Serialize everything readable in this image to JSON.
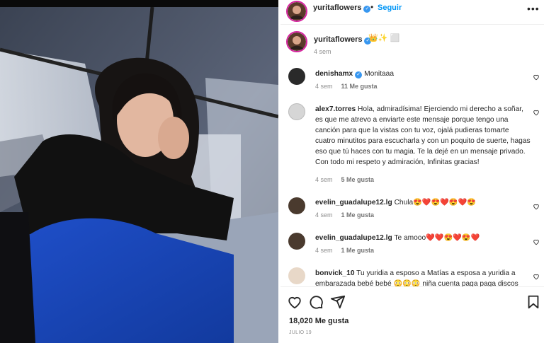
{
  "post": {
    "username": "yuritaflowers",
    "follow_label": "Seguir",
    "separator": "•",
    "more_label": "•••",
    "caption_emoji": "👑✨ ⬜",
    "caption_time": "4 sem"
  },
  "comments": [
    {
      "user": "denishamx",
      "verified": true,
      "text": "Monitaaa",
      "time": "4 sem",
      "likes": "11 Me gusta",
      "avatar_color": "#2a2a2a"
    },
    {
      "user": "alex7.torres",
      "verified": false,
      "text": "Hola, admiradísima! Ejerciendo mi derecho a soñar, es que me atrevo a enviarte este mensaje porque tengo una canción para que la vistas con tu voz, ojalá pudieras tomarte cuatro minutitos para escucharla y con un poquito de suerte, hagas eso que tú haces con tu magia. Te la dejé en un mensaje privado. Con todo mi respeto y admiración, Infinitas gracias!",
      "time": "4 sem",
      "likes": "5 Me gusta",
      "avatar_color": "#c9c9c9"
    },
    {
      "user": "evelin_guadalupe12.lg",
      "verified": false,
      "text": "Chula😍❤️😍❤️😍❤️😍",
      "time": "4 sem",
      "likes": "1 Me gusta",
      "avatar_color": "#4a3a2e"
    },
    {
      "user": "evelin_guadalupe12.lg",
      "verified": false,
      "text": "Te amooo❤️❤️😍❤️😍❤️",
      "time": "4 sem",
      "likes": "1 Me gusta",
      "avatar_color": "#4a3a2e"
    },
    {
      "user": "bonvick_10",
      "verified": false,
      "text": "Tu yuridia a esposo a Matías a esposa a yuridia a embarazada bebé bebé 😳😳😳 niña cuenta paga paga discos",
      "time": "",
      "likes": "",
      "avatar_color": "#e8d8c8"
    }
  ],
  "footer": {
    "likes_count": "18,020 Me gusta",
    "date": "JULIO 19"
  },
  "colors": {
    "accent": "#0095f6",
    "verified": "#3897f0",
    "text": "#262626",
    "muted": "#8e8e8e",
    "heart": "#ed4956"
  },
  "icons": [
    "heart-icon",
    "comment-icon",
    "share-icon",
    "bookmark-icon",
    "more-icon",
    "verified-icon"
  ]
}
